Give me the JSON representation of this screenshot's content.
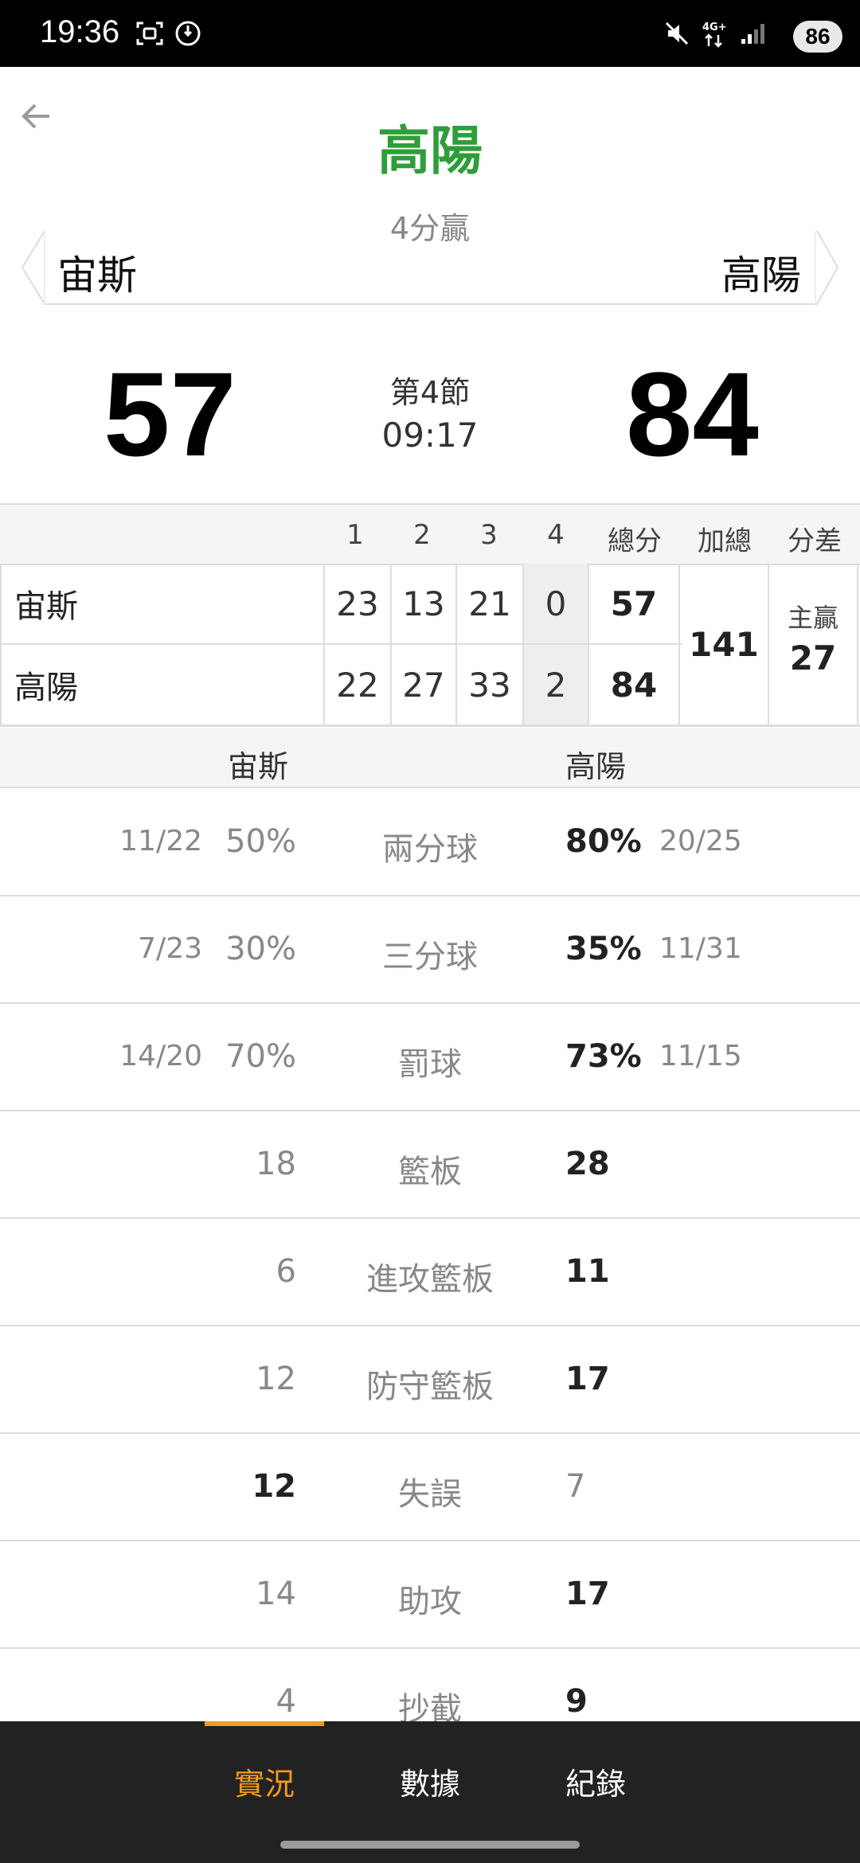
{
  "status_bar": {
    "time": "19:36",
    "battery": "86"
  },
  "header": {
    "winner": "高陽",
    "result": "4分贏"
  },
  "teams": {
    "away": "宙斯",
    "home": "高陽"
  },
  "scoreboard": {
    "away_score": "57",
    "home_score": "84",
    "period": "第4節",
    "clock": "09:17"
  },
  "box_score": {
    "headers": [
      "1",
      "2",
      "3",
      "4",
      "總分",
      "加總",
      "分差"
    ],
    "rows": [
      {
        "team": "宙斯",
        "q": [
          "23",
          "13",
          "21",
          "0"
        ],
        "total": "57"
      },
      {
        "team": "高陽",
        "q": [
          "22",
          "27",
          "33",
          "2"
        ],
        "total": "84"
      }
    ],
    "combined": "141",
    "diff_label": "主贏",
    "diff_value": "27"
  },
  "stats": {
    "away_team": "宙斯",
    "home_team": "高陽",
    "rows": [
      {
        "name": "兩分球",
        "away_frac": "11/22",
        "away": "50%",
        "home": "80%",
        "home_frac": "20/25"
      },
      {
        "name": "三分球",
        "away_frac": "7/23",
        "away": "30%",
        "home": "35%",
        "home_frac": "11/31"
      },
      {
        "name": "罰球",
        "away_frac": "14/20",
        "away": "70%",
        "home": "73%",
        "home_frac": "11/15"
      },
      {
        "name": "籃板",
        "away_frac": "",
        "away": "18",
        "home": "28",
        "home_frac": ""
      },
      {
        "name": "進攻籃板",
        "away_frac": "",
        "away": "6",
        "home": "11",
        "home_frac": ""
      },
      {
        "name": "防守籃板",
        "away_frac": "",
        "away": "12",
        "home": "17",
        "home_frac": ""
      },
      {
        "name": "失誤",
        "away_frac": "",
        "away": "12",
        "home": "7",
        "home_frac": ""
      },
      {
        "name": "助攻",
        "away_frac": "",
        "away": "14",
        "home": "17",
        "home_frac": ""
      },
      {
        "name": "抄截",
        "away_frac": "",
        "away": "4",
        "home": "9",
        "home_frac": ""
      }
    ]
  },
  "bottom_nav": {
    "tabs": [
      "實況",
      "數據",
      "紀錄"
    ],
    "active": "實況"
  },
  "colors": {
    "winner_green": "#2e9e3a",
    "accent_orange": "#f39a1f",
    "nav_bg": "#222222"
  }
}
